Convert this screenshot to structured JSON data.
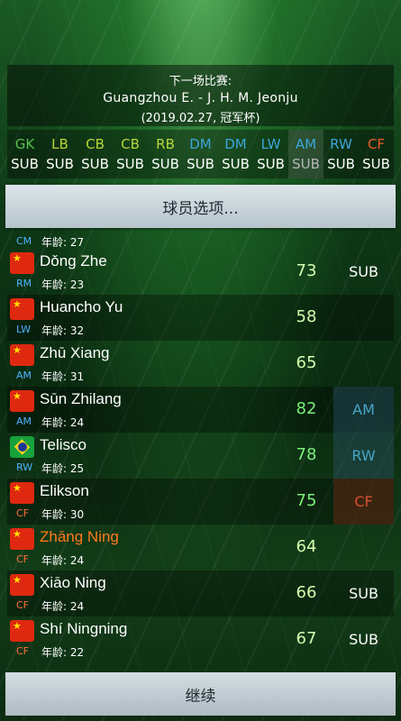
{
  "match": {
    "label": "下一场比赛:",
    "teams": "Guangzhou E. - J. H. M. Jeonju",
    "info": "(2019.02.27, 冠军杯)"
  },
  "positions": [
    {
      "abbr": "GK",
      "color": "#59c24f",
      "value": "SUB"
    },
    {
      "abbr": "LB",
      "color": "#b7d63a",
      "value": "SUB"
    },
    {
      "abbr": "CB",
      "color": "#b7d63a",
      "value": "SUB"
    },
    {
      "abbr": "CB",
      "color": "#b7d63a",
      "value": "SUB"
    },
    {
      "abbr": "RB",
      "color": "#b7d63a",
      "value": "SUB"
    },
    {
      "abbr": "DM",
      "color": "#3aa6d8",
      "value": "SUB"
    },
    {
      "abbr": "DM",
      "color": "#3aa6d8",
      "value": "SUB"
    },
    {
      "abbr": "LW",
      "color": "#3aa6d8",
      "value": "SUB"
    },
    {
      "abbr": "AM",
      "color": "#3aa6d8",
      "value": "SUB"
    },
    {
      "abbr": "RW",
      "color": "#3aa6d8",
      "value": "SUB"
    },
    {
      "abbr": "CF",
      "color": "#ef5a2a",
      "value": "SUB"
    }
  ],
  "options_button": "球员选项...",
  "partial_row": {
    "pos": "CM",
    "age_label": "年龄:",
    "age": "27"
  },
  "players": [
    {
      "flag": "cn",
      "name": "Dǒng Zhe",
      "pos": "RM",
      "age": "23",
      "rating": "73",
      "status": "SUB"
    },
    {
      "flag": "cn",
      "name": "Huancho Yu",
      "pos": "LW",
      "age": "32",
      "rating": "58",
      "status": ""
    },
    {
      "flag": "cn",
      "name": "Zhū Xiang",
      "pos": "AM",
      "age": "31",
      "rating": "65",
      "status": ""
    },
    {
      "flag": "cn",
      "name": "Sūn Zhilang",
      "pos": "AM",
      "age": "24",
      "rating": "82",
      "status": "AM"
    },
    {
      "flag": "br",
      "name": "Telisco",
      "pos": "RW",
      "age": "25",
      "rating": "78",
      "status": "RW"
    },
    {
      "flag": "cn",
      "name": "Elikson",
      "pos": "CF",
      "age": "30",
      "rating": "75",
      "status": "CF"
    },
    {
      "flag": "cn",
      "name": "Zhāng Ning",
      "pos": "CF",
      "age": "24",
      "rating": "64",
      "status": ""
    },
    {
      "flag": "cn",
      "name": "Xiāo Ning",
      "pos": "CF",
      "age": "24",
      "rating": "66",
      "status": "SUB"
    },
    {
      "flag": "cn",
      "name": "Shí Ningning",
      "pos": "CF",
      "age": "22",
      "rating": "67",
      "status": "SUB"
    }
  ],
  "age_label": "年龄:",
  "continue_button": "继续"
}
